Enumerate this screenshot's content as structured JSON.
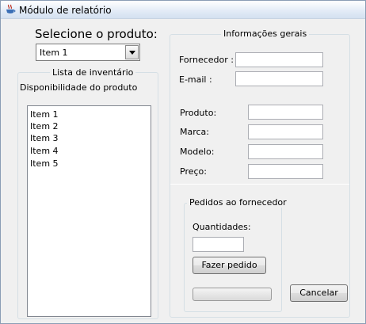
{
  "window": {
    "title": "Módulo de relatório",
    "icon": "java-cup-icon"
  },
  "product_select": {
    "label": "Selecione o produto:",
    "selected": "Item 1"
  },
  "inventory": {
    "group_title": "Lista de inventário",
    "availability_label": "Disponibilidade do produto",
    "items": [
      "Item 1",
      "Item 2",
      "Item 3",
      "Item 4",
      "Item 5"
    ]
  },
  "general_info": {
    "group_title": "Informações gerais",
    "supplier_label": "Fornecedor :",
    "email_label": "E-mail :",
    "product_label": "Produto:",
    "brand_label": "Marca:",
    "model_label": "Modelo:",
    "price_label": "Preço:"
  },
  "orders": {
    "group_title": "Pedidos ao fornecedor",
    "quantities_label": "Quantidades:",
    "order_button": "Fazer pedido",
    "progress": 0
  },
  "cancel_button": "Cancelar"
}
